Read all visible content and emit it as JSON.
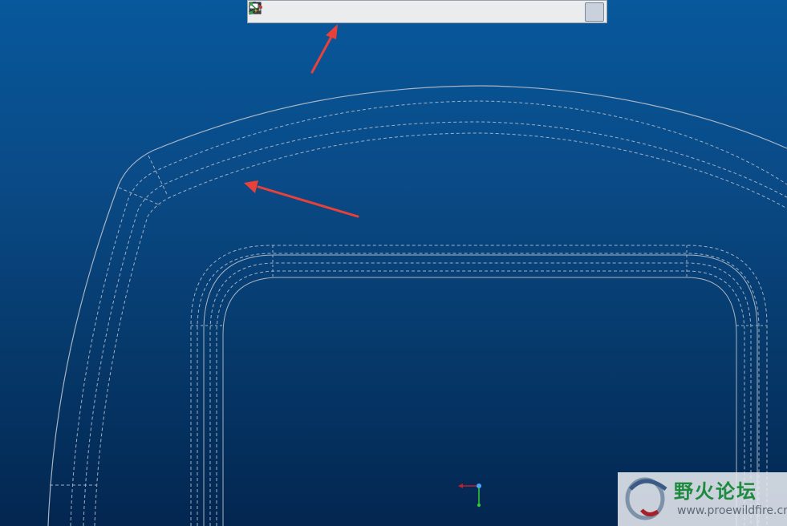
{
  "toolbar": {
    "buttons": [
      {
        "icon": "refit-icon",
        "active": false
      },
      {
        "icon": "zoom-in-icon",
        "active": false
      },
      {
        "icon": "zoom-out-icon",
        "active": false
      },
      {
        "icon": "repaint-icon",
        "active": false
      },
      {
        "icon": "display-style-icon",
        "active": false
      },
      {
        "icon": "saved-views-icon",
        "active": false
      },
      {
        "icon": "view-manager-icon",
        "active": false
      },
      {
        "icon": "view-normal-icon",
        "active": false
      },
      {
        "icon": "spin-center-icon",
        "active": false
      },
      {
        "icon": "perspective-icon",
        "active": false
      },
      {
        "icon": "annotation-display-icon",
        "active": false
      },
      {
        "icon": "plane-display-icon",
        "active": false
      },
      {
        "icon": "axis-display-icon",
        "active": false
      },
      {
        "icon": "point-display-icon",
        "active": false
      },
      {
        "icon": "csys-display-icon",
        "active": false
      },
      {
        "icon": "spin-center-display-icon",
        "active": false
      },
      {
        "icon": "annotation-toggle-icon",
        "active": true
      }
    ]
  },
  "watermark": {
    "title": "野火论坛",
    "url": "www.proewildfire.cn"
  },
  "colors": {
    "background_top": "#07589c",
    "background_bottom": "#032650",
    "edge_line": "#a8b4c2",
    "hidden_line": "#9fb0c4",
    "annotation_arrow": "#e8413a",
    "triad_x": "#c0202a",
    "triad_y": "#2fd12f",
    "triad_origin": "#4fa3ff",
    "watermark_green": "#1e8a3e"
  }
}
